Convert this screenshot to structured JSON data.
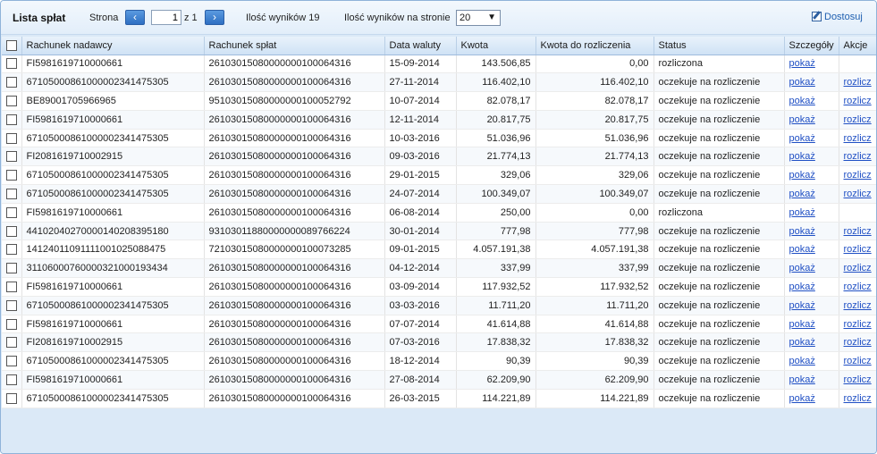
{
  "toolbar": {
    "title": "Lista spłat",
    "page_label": "Strona",
    "prev_icon": "‹",
    "next_icon": "›",
    "page_value": "1",
    "of_label": "z 1",
    "results_label": "Ilość wyników 19",
    "perpage_label": "Ilość wyników na stronie",
    "perpage_value": "20",
    "customize_label": "Dostosuj",
    "customize_icon": "edit-icon"
  },
  "columns": [
    "Rachunek nadawcy",
    "Rachunek spłat",
    "Data waluty",
    "Kwota",
    "Kwota do rozliczenia",
    "Status",
    "Szczegóły",
    "Akcje"
  ],
  "rows": [
    {
      "sender": "FI5981619710000661",
      "account": "26103015080000000100064316",
      "date": "15-09-2014",
      "amount": "143.506,85",
      "to_settle": "0,00",
      "status": "rozliczona",
      "details": "pokaż",
      "action": ""
    },
    {
      "sender": "67105000861000002341475305",
      "account": "26103015080000000100064316",
      "date": "27-11-2014",
      "amount": "116.402,10",
      "to_settle": "116.402,10",
      "status": "oczekuje na rozliczenie",
      "details": "pokaż",
      "action": "rozlicz"
    },
    {
      "sender": "BE89001705966965",
      "account": "95103015080000000100052792",
      "date": "10-07-2014",
      "amount": "82.078,17",
      "to_settle": "82.078,17",
      "status": "oczekuje na rozliczenie",
      "details": "pokaż",
      "action": "rozlicz"
    },
    {
      "sender": "FI5981619710000661",
      "account": "26103015080000000100064316",
      "date": "12-11-2014",
      "amount": "20.817,75",
      "to_settle": "20.817,75",
      "status": "oczekuje na rozliczenie",
      "details": "pokaż",
      "action": "rozlicz"
    },
    {
      "sender": "67105000861000002341475305",
      "account": "26103015080000000100064316",
      "date": "10-03-2016",
      "amount": "51.036,96",
      "to_settle": "51.036,96",
      "status": "oczekuje na rozliczenie",
      "details": "pokaż",
      "action": "rozlicz"
    },
    {
      "sender": "FI2081619710002915",
      "account": "26103015080000000100064316",
      "date": "09-03-2016",
      "amount": "21.774,13",
      "to_settle": "21.774,13",
      "status": "oczekuje na rozliczenie",
      "details": "pokaż",
      "action": "rozlicz"
    },
    {
      "sender": "67105000861000002341475305",
      "account": "26103015080000000100064316",
      "date": "29-01-2015",
      "amount": "329,06",
      "to_settle": "329,06",
      "status": "oczekuje na rozliczenie",
      "details": "pokaż",
      "action": "rozlicz"
    },
    {
      "sender": "67105000861000002341475305",
      "account": "26103015080000000100064316",
      "date": "24-07-2014",
      "amount": "100.349,07",
      "to_settle": "100.349,07",
      "status": "oczekuje na rozliczenie",
      "details": "pokaż",
      "action": "rozlicz"
    },
    {
      "sender": "FI5981619710000661",
      "account": "26103015080000000100064316",
      "date": "06-08-2014",
      "amount": "250,00",
      "to_settle": "0,00",
      "status": "rozliczona",
      "details": "pokaż",
      "action": ""
    },
    {
      "sender": "44102040270000140208395180",
      "account": "93103011880000000089766224",
      "date": "30-01-2014",
      "amount": "777,98",
      "to_settle": "777,98",
      "status": "oczekuje na rozliczenie",
      "details": "pokaż",
      "action": "rozlicz"
    },
    {
      "sender": "14124011091111001025088475",
      "account": "72103015080000000100073285",
      "date": "09-01-2015",
      "amount": "4.057.191,38",
      "to_settle": "4.057.191,38",
      "status": "oczekuje na rozliczenie",
      "details": "pokaż",
      "action": "rozlicz"
    },
    {
      "sender": "31106000760000321000193434",
      "account": "26103015080000000100064316",
      "date": "04-12-2014",
      "amount": "337,99",
      "to_settle": "337,99",
      "status": "oczekuje na rozliczenie",
      "details": "pokaż",
      "action": "rozlicz"
    },
    {
      "sender": "FI5981619710000661",
      "account": "26103015080000000100064316",
      "date": "03-09-2014",
      "amount": "117.932,52",
      "to_settle": "117.932,52",
      "status": "oczekuje na rozliczenie",
      "details": "pokaż",
      "action": "rozlicz"
    },
    {
      "sender": "67105000861000002341475305",
      "account": "26103015080000000100064316",
      "date": "03-03-2016",
      "amount": "11.711,20",
      "to_settle": "11.711,20",
      "status": "oczekuje na rozliczenie",
      "details": "pokaż",
      "action": "rozlicz"
    },
    {
      "sender": "FI5981619710000661",
      "account": "26103015080000000100064316",
      "date": "07-07-2014",
      "amount": "41.614,88",
      "to_settle": "41.614,88",
      "status": "oczekuje na rozliczenie",
      "details": "pokaż",
      "action": "rozlicz"
    },
    {
      "sender": "FI2081619710002915",
      "account": "26103015080000000100064316",
      "date": "07-03-2016",
      "amount": "17.838,32",
      "to_settle": "17.838,32",
      "status": "oczekuje na rozliczenie",
      "details": "pokaż",
      "action": "rozlicz"
    },
    {
      "sender": "67105000861000002341475305",
      "account": "26103015080000000100064316",
      "date": "18-12-2014",
      "amount": "90,39",
      "to_settle": "90,39",
      "status": "oczekuje na rozliczenie",
      "details": "pokaż",
      "action": "rozlicz"
    },
    {
      "sender": "FI5981619710000661",
      "account": "26103015080000000100064316",
      "date": "27-08-2014",
      "amount": "62.209,90",
      "to_settle": "62.209,90",
      "status": "oczekuje na rozliczenie",
      "details": "pokaż",
      "action": "rozlicz"
    },
    {
      "sender": "67105000861000002341475305",
      "account": "26103015080000000100064316",
      "date": "26-03-2015",
      "amount": "114.221,89",
      "to_settle": "114.221,89",
      "status": "oczekuje na rozliczenie",
      "details": "pokaż",
      "action": "rozlicz"
    }
  ]
}
